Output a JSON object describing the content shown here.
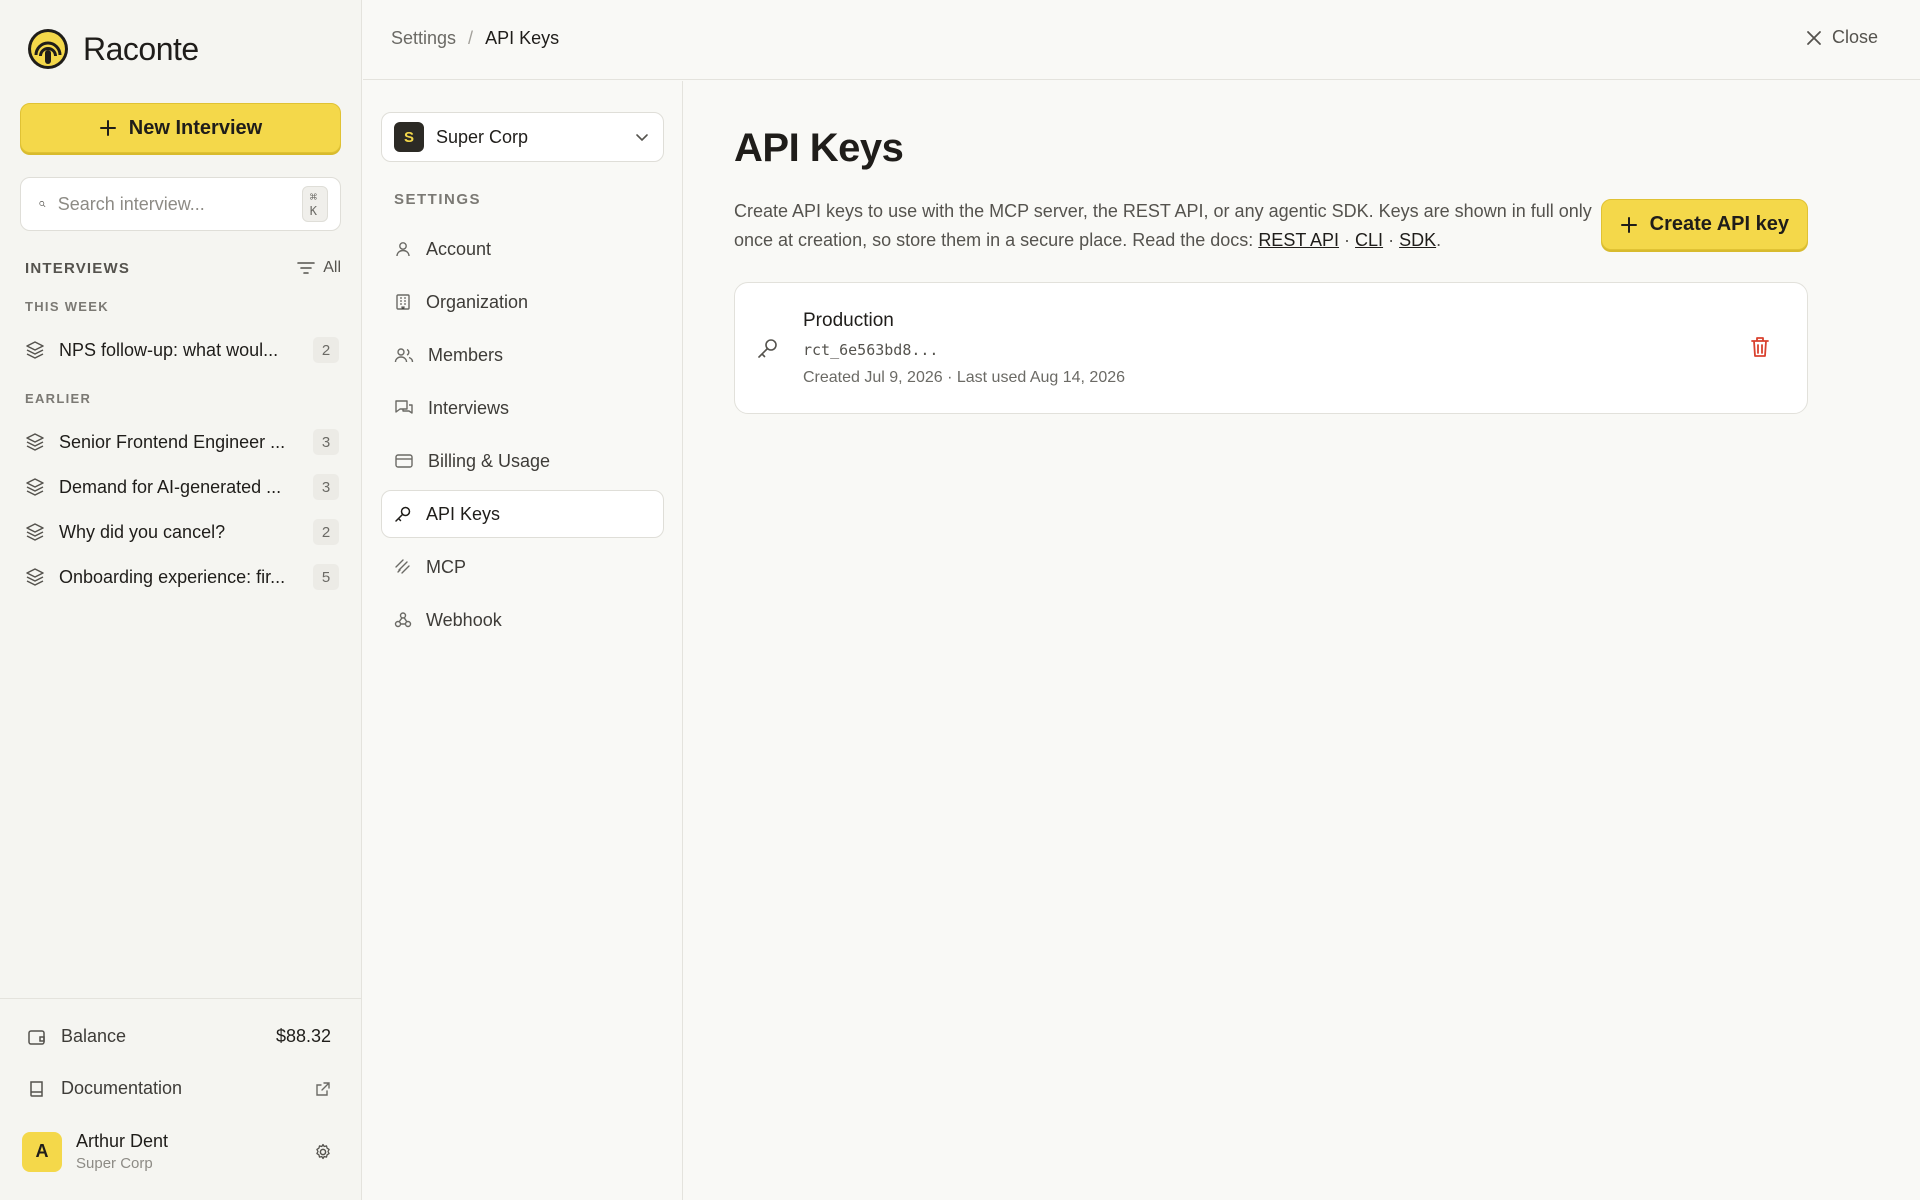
{
  "app": {
    "name": "Raconte"
  },
  "sidebar": {
    "new_interview_label": "New Interview",
    "search": {
      "placeholder": "Search interview...",
      "shortcut": "⌘ K"
    },
    "section_title": "INTERVIEWS",
    "filter_label": "All",
    "groups": [
      {
        "label": "THIS WEEK",
        "items": [
          {
            "title": "NPS follow-up: what woul...",
            "count": "2"
          }
        ]
      },
      {
        "label": "EARLIER",
        "items": [
          {
            "title": "Senior Frontend Engineer ...",
            "count": "3"
          },
          {
            "title": "Demand for AI-generated ...",
            "count": "3"
          },
          {
            "title": "Why did you cancel?",
            "count": "2"
          },
          {
            "title": "Onboarding experience: fir...",
            "count": "5"
          }
        ]
      }
    ],
    "balance": {
      "label": "Balance",
      "value": "$88.32"
    },
    "documentation": {
      "label": "Documentation"
    },
    "user": {
      "initial": "A",
      "name": "Arthur Dent",
      "org": "Super Corp"
    }
  },
  "topbar": {
    "breadcrumb": [
      "Settings",
      "API Keys"
    ],
    "separator": "/",
    "close_label": "Close"
  },
  "settings_nav": {
    "org": {
      "initial": "S",
      "name": "Super Corp"
    },
    "section_label": "SETTINGS",
    "items": [
      {
        "label": "Account",
        "icon": "user-icon"
      },
      {
        "label": "Organization",
        "icon": "building-icon"
      },
      {
        "label": "Members",
        "icon": "users-icon"
      },
      {
        "label": "Interviews",
        "icon": "chat-icon"
      },
      {
        "label": "Billing & Usage",
        "icon": "credit-card-icon"
      },
      {
        "label": "API Keys",
        "icon": "key-icon",
        "active": true
      },
      {
        "label": "MCP",
        "icon": "mcp-icon"
      },
      {
        "label": "Webhook",
        "icon": "webhook-icon"
      }
    ]
  },
  "main": {
    "title": "API Keys",
    "description": "Create API keys to use with the MCP server, the REST API, or any agentic SDK. Keys are shown in full only once at creation, so store them in a secure place. Read the docs:",
    "doc_links": [
      "REST API",
      "CLI",
      "SDK"
    ],
    "link_separator": "·",
    "create_label": "Create API key",
    "keys": [
      {
        "name": "Production",
        "prefix": "rct_6e563bd8...",
        "meta": "Created Jul 9, 2026 · Last used Aug 14, 2026"
      }
    ]
  },
  "colors": {
    "accent": "#f4d84a",
    "danger": "#d9412e",
    "background": "#f9f9f6"
  }
}
